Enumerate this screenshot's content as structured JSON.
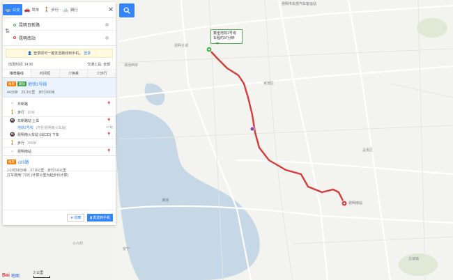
{
  "modes": [
    {
      "label": "公交",
      "icon": "bus-icon",
      "glyph": "🚌"
    },
    {
      "label": "驾车",
      "icon": "car-icon",
      "glyph": "🚗"
    },
    {
      "label": "步行",
      "icon": "walk-icon",
      "glyph": "🚶"
    },
    {
      "label": "骑行",
      "icon": "bike-icon",
      "glyph": "🚲"
    }
  ],
  "route": {
    "origin": "昆明日新路",
    "destination": "昆明南站"
  },
  "notice": {
    "text": "登录即可一键发送路线到手机，",
    "link": "登录"
  },
  "options": {
    "departure": "出发时间: 14:30",
    "transport": "交通工具: 全部"
  },
  "tabs": [
    "推荐路线",
    "时间短",
    "少换乘",
    "少步行"
  ],
  "plan1": {
    "badge_rec": "推荐",
    "badge_fast": "最快",
    "title": "地铁1号线",
    "duration": "44分钟",
    "distance": "23.3公里",
    "walk": "步行300米",
    "steps": [
      {
        "icon": "○",
        "text": "日新路",
        "sub": ""
      },
      {
        "icon": "🚶",
        "text": "步行",
        "sub": "10米"
      },
      {
        "icon": "🚇",
        "text": "日新路站 上车",
        "sub": ""
      },
      {
        "icon": "",
        "text": "地铁1号线",
        "sub": "(开往昆明南火车站)"
      },
      {
        "icon": "🚇",
        "text": "昆明南火车站 (出口D) 下车",
        "sub": ""
      },
      {
        "icon": "🚶",
        "text": "步行",
        "sub": "300米"
      },
      {
        "icon": "○",
        "text": "昆明南站",
        "sub": ""
      }
    ],
    "stops": "17站"
  },
  "plan2": {
    "badge": "推荐",
    "name": "c85路",
    "duration": "1小时58分钟",
    "distance": "27.8公里",
    "walk": "步行3.6公里"
  },
  "taxi": "打车费用: 73元 (计算公里为起步价计算)",
  "actions": {
    "fav": "收藏",
    "send": "发送到手机"
  },
  "callout": {
    "line1": "乘坐地铁1号线",
    "line2": "车程约37分钟"
  },
  "map_labels": [
    "昆明市东部汽车客运站",
    "官渡区",
    "昆明主城",
    "滇池西岸",
    "滇池",
    "昆明南站",
    "呈贡区",
    "安宁",
    "小六村",
    "古城镇"
  ],
  "logo": {
    "bai": "Bai",
    "du": "地图"
  },
  "scale": "2 公里",
  "colors": {
    "accent": "#3385ff",
    "route": "#d63a3a",
    "water": "#c6d7e6"
  }
}
